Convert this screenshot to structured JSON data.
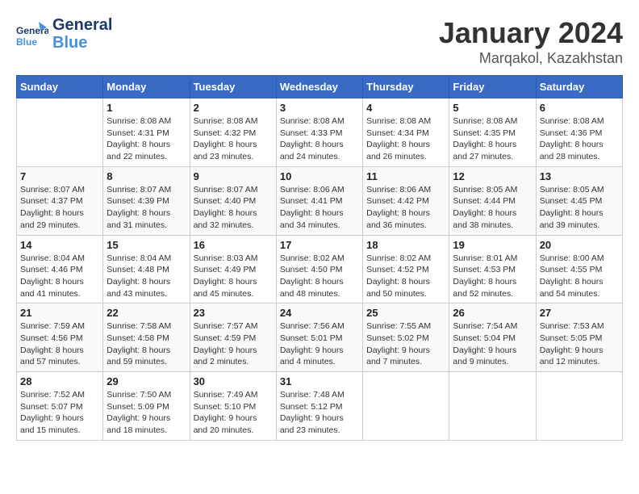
{
  "header": {
    "logo_general": "General",
    "logo_blue": "Blue",
    "title": "January 2024",
    "subtitle": "Marqakol, Kazakhstan"
  },
  "weekdays": [
    "Sunday",
    "Monday",
    "Tuesday",
    "Wednesday",
    "Thursday",
    "Friday",
    "Saturday"
  ],
  "weeks": [
    [
      {
        "day": "",
        "info": ""
      },
      {
        "day": "1",
        "info": "Sunrise: 8:08 AM\nSunset: 4:31 PM\nDaylight: 8 hours\nand 22 minutes."
      },
      {
        "day": "2",
        "info": "Sunrise: 8:08 AM\nSunset: 4:32 PM\nDaylight: 8 hours\nand 23 minutes."
      },
      {
        "day": "3",
        "info": "Sunrise: 8:08 AM\nSunset: 4:33 PM\nDaylight: 8 hours\nand 24 minutes."
      },
      {
        "day": "4",
        "info": "Sunrise: 8:08 AM\nSunset: 4:34 PM\nDaylight: 8 hours\nand 26 minutes."
      },
      {
        "day": "5",
        "info": "Sunrise: 8:08 AM\nSunset: 4:35 PM\nDaylight: 8 hours\nand 27 minutes."
      },
      {
        "day": "6",
        "info": "Sunrise: 8:08 AM\nSunset: 4:36 PM\nDaylight: 8 hours\nand 28 minutes."
      }
    ],
    [
      {
        "day": "7",
        "info": "Sunrise: 8:07 AM\nSunset: 4:37 PM\nDaylight: 8 hours\nand 29 minutes."
      },
      {
        "day": "8",
        "info": "Sunrise: 8:07 AM\nSunset: 4:39 PM\nDaylight: 8 hours\nand 31 minutes."
      },
      {
        "day": "9",
        "info": "Sunrise: 8:07 AM\nSunset: 4:40 PM\nDaylight: 8 hours\nand 32 minutes."
      },
      {
        "day": "10",
        "info": "Sunrise: 8:06 AM\nSunset: 4:41 PM\nDaylight: 8 hours\nand 34 minutes."
      },
      {
        "day": "11",
        "info": "Sunrise: 8:06 AM\nSunset: 4:42 PM\nDaylight: 8 hours\nand 36 minutes."
      },
      {
        "day": "12",
        "info": "Sunrise: 8:05 AM\nSunset: 4:44 PM\nDaylight: 8 hours\nand 38 minutes."
      },
      {
        "day": "13",
        "info": "Sunrise: 8:05 AM\nSunset: 4:45 PM\nDaylight: 8 hours\nand 39 minutes."
      }
    ],
    [
      {
        "day": "14",
        "info": "Sunrise: 8:04 AM\nSunset: 4:46 PM\nDaylight: 8 hours\nand 41 minutes."
      },
      {
        "day": "15",
        "info": "Sunrise: 8:04 AM\nSunset: 4:48 PM\nDaylight: 8 hours\nand 43 minutes."
      },
      {
        "day": "16",
        "info": "Sunrise: 8:03 AM\nSunset: 4:49 PM\nDaylight: 8 hours\nand 45 minutes."
      },
      {
        "day": "17",
        "info": "Sunrise: 8:02 AM\nSunset: 4:50 PM\nDaylight: 8 hours\nand 48 minutes."
      },
      {
        "day": "18",
        "info": "Sunrise: 8:02 AM\nSunset: 4:52 PM\nDaylight: 8 hours\nand 50 minutes."
      },
      {
        "day": "19",
        "info": "Sunrise: 8:01 AM\nSunset: 4:53 PM\nDaylight: 8 hours\nand 52 minutes."
      },
      {
        "day": "20",
        "info": "Sunrise: 8:00 AM\nSunset: 4:55 PM\nDaylight: 8 hours\nand 54 minutes."
      }
    ],
    [
      {
        "day": "21",
        "info": "Sunrise: 7:59 AM\nSunset: 4:56 PM\nDaylight: 8 hours\nand 57 minutes."
      },
      {
        "day": "22",
        "info": "Sunrise: 7:58 AM\nSunset: 4:58 PM\nDaylight: 8 hours\nand 59 minutes."
      },
      {
        "day": "23",
        "info": "Sunrise: 7:57 AM\nSunset: 4:59 PM\nDaylight: 9 hours\nand 2 minutes."
      },
      {
        "day": "24",
        "info": "Sunrise: 7:56 AM\nSunset: 5:01 PM\nDaylight: 9 hours\nand 4 minutes."
      },
      {
        "day": "25",
        "info": "Sunrise: 7:55 AM\nSunset: 5:02 PM\nDaylight: 9 hours\nand 7 minutes."
      },
      {
        "day": "26",
        "info": "Sunrise: 7:54 AM\nSunset: 5:04 PM\nDaylight: 9 hours\nand 9 minutes."
      },
      {
        "day": "27",
        "info": "Sunrise: 7:53 AM\nSunset: 5:05 PM\nDaylight: 9 hours\nand 12 minutes."
      }
    ],
    [
      {
        "day": "28",
        "info": "Sunrise: 7:52 AM\nSunset: 5:07 PM\nDaylight: 9 hours\nand 15 minutes."
      },
      {
        "day": "29",
        "info": "Sunrise: 7:50 AM\nSunset: 5:09 PM\nDaylight: 9 hours\nand 18 minutes."
      },
      {
        "day": "30",
        "info": "Sunrise: 7:49 AM\nSunset: 5:10 PM\nDaylight: 9 hours\nand 20 minutes."
      },
      {
        "day": "31",
        "info": "Sunrise: 7:48 AM\nSunset: 5:12 PM\nDaylight: 9 hours\nand 23 minutes."
      },
      {
        "day": "",
        "info": ""
      },
      {
        "day": "",
        "info": ""
      },
      {
        "day": "",
        "info": ""
      }
    ]
  ]
}
